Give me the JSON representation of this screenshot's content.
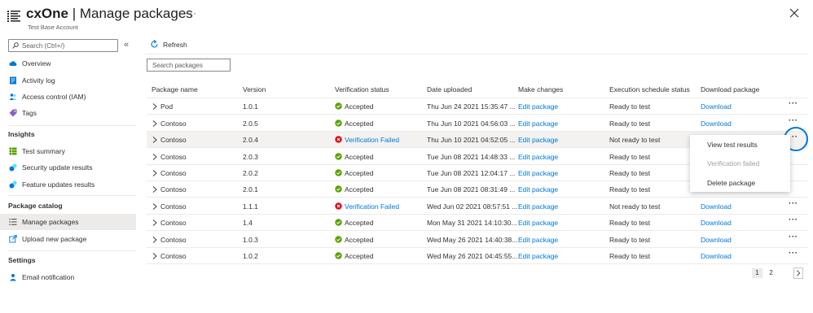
{
  "header": {
    "title_bold": "cxOne",
    "title_rest": " | Manage packages",
    "more": "···",
    "subtitle": "Test Base Account"
  },
  "sidebar": {
    "search_placeholder": "Search (Ctrl+/)",
    "collapse": "«",
    "items": [
      {
        "label": "Overview",
        "icon": "cloud-icon"
      },
      {
        "label": "Activity log",
        "icon": "activity-log-icon"
      },
      {
        "label": "Access control (IAM)",
        "icon": "people-icon"
      },
      {
        "label": "Tags",
        "icon": "tag-icon"
      }
    ],
    "sections": [
      {
        "title": "Insights",
        "items": [
          {
            "label": "Test summary",
            "icon": "grid-icon"
          },
          {
            "label": "Security update results",
            "icon": "security-update-icon"
          },
          {
            "label": "Feature updates results",
            "icon": "feature-update-icon"
          }
        ]
      },
      {
        "title": "Package catalog",
        "items": [
          {
            "label": "Manage packages",
            "icon": "list-icon",
            "active": true
          },
          {
            "label": "Upload new package",
            "icon": "upload-icon"
          }
        ]
      },
      {
        "title": "Settings",
        "items": [
          {
            "label": "Email notification",
            "icon": "person-icon"
          }
        ]
      }
    ]
  },
  "toolbar": {
    "refresh": "Refresh"
  },
  "filter": {
    "placeholder": "Search packages"
  },
  "table": {
    "headers": [
      "Package name",
      "Version",
      "Verification status",
      "Date uploaded",
      "Make changes",
      "Execution schedule status",
      "Download package"
    ],
    "rows": [
      {
        "name": "Pod",
        "version": "1.0.1",
        "status": "Accepted",
        "date": "Thu Jun 24 2021 15:35:47 ...",
        "edit": "Edit package",
        "exec": "Ready to test",
        "download": "Download",
        "more": "···"
      },
      {
        "name": "Contoso",
        "version": "2.0.5",
        "status": "Accepted",
        "date": "Thu Jun 10 2021 04:56:03 ...",
        "edit": "Edit package",
        "exec": "Ready to test",
        "download": "Download",
        "more": "···"
      },
      {
        "name": "Contoso",
        "version": "2.0.4",
        "status": "Verification Failed",
        "date": "Thu Jun 10 2021 04:52:05 ...",
        "edit": "Edit package",
        "exec": "Not ready to test",
        "download": "",
        "more": "···"
      },
      {
        "name": "Contoso",
        "version": "2.0.3",
        "status": "Accepted",
        "date": "Tue Jun 08 2021 14:48:33 ...",
        "edit": "Edit package",
        "exec": "Ready to test",
        "download": "",
        "more": ""
      },
      {
        "name": "Contoso",
        "version": "2.0.2",
        "status": "Accepted",
        "date": "Tue Jun 08 2021 12:04:17 ...",
        "edit": "Edit package",
        "exec": "Ready to test",
        "download": "",
        "more": ""
      },
      {
        "name": "Contoso",
        "version": "2.0.1",
        "status": "Accepted",
        "date": "Tue Jun 08 2021 08:31:49 ...",
        "edit": "Edit package",
        "exec": "Ready to test",
        "download": "",
        "more": ""
      },
      {
        "name": "Contoso",
        "version": "1.1.1",
        "status": "Verification Failed",
        "date": "Wed Jun 02 2021 08:57:51 ...",
        "edit": "Edit package",
        "exec": "Not ready to test",
        "download": "Download",
        "more": "···"
      },
      {
        "name": "Contoso",
        "version": "1.4",
        "status": "Accepted",
        "date": "Mon May 31 2021 14:10:30...",
        "edit": "Edit package",
        "exec": "Ready to test",
        "download": "Download",
        "more": "···"
      },
      {
        "name": "Contoso",
        "version": "1.0.3",
        "status": "Accepted",
        "date": "Wed May 26 2021 14:40:38...",
        "edit": "Edit package",
        "exec": "Ready to test",
        "download": "Download",
        "more": "···"
      },
      {
        "name": "Contoso",
        "version": "1.0.2",
        "status": "Accepted",
        "date": "Wed May 26 2021 04:45:55...",
        "edit": "Edit package",
        "exec": "Ready to test",
        "download": "Download",
        "more": "···"
      }
    ]
  },
  "context_menu": {
    "items": [
      {
        "label": "View test results",
        "disabled": false
      },
      {
        "label": "Verification failed",
        "disabled": true
      },
      {
        "label": "Delete package",
        "disabled": false
      }
    ]
  },
  "pager": {
    "pages": [
      "1",
      "2"
    ],
    "current": "1"
  },
  "colors": {
    "accent": "#0078d4",
    "success": "#57a300",
    "error": "#e00b1c",
    "active_bg": "#edebe9"
  }
}
